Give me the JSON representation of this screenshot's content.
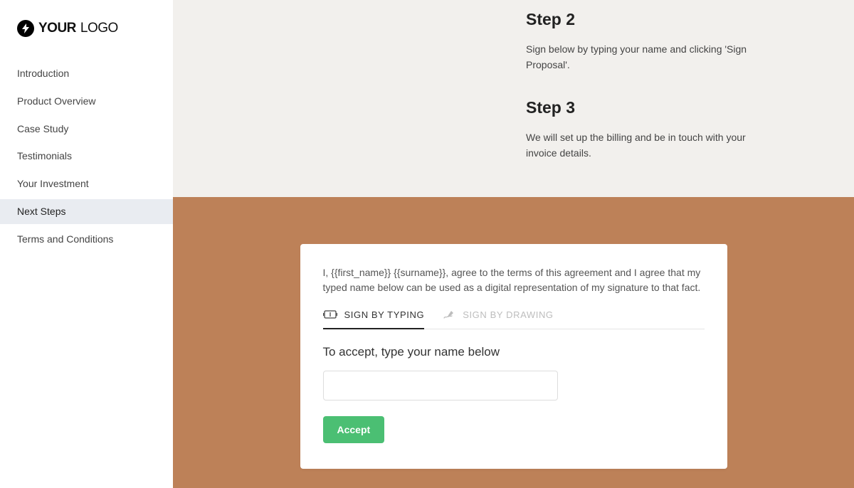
{
  "logo": {
    "part1": "YOUR",
    "part2": "LOGO",
    "icon": "bolt-icon"
  },
  "sidebar": {
    "items": [
      {
        "label": "Introduction",
        "active": false
      },
      {
        "label": "Product Overview",
        "active": false
      },
      {
        "label": "Case Study",
        "active": false
      },
      {
        "label": "Testimonials",
        "active": false
      },
      {
        "label": "Your Investment",
        "active": false
      },
      {
        "label": "Next Steps",
        "active": true
      },
      {
        "label": "Terms and Conditions",
        "active": false
      }
    ]
  },
  "steps": {
    "step2": {
      "title": "Step 2",
      "body": "Sign below by typing your name and clicking 'Sign Proposal'."
    },
    "step3": {
      "title": "Step 3",
      "body": "We will set up the billing and be in touch with your invoice details."
    }
  },
  "signCard": {
    "agreement": "I, {{first_name}} {{surname}}, agree to the terms of this agreement and I agree that my typed name below can be used as a digital representation of my signature to that fact.",
    "tabs": {
      "typing": "SIGN BY TYPING",
      "drawing": "SIGN BY DRAWING"
    },
    "fieldLabel": "To accept, type your name below",
    "nameValue": "",
    "acceptLabel": "Accept"
  },
  "colors": {
    "signBg": "#bd8158",
    "acceptBtn": "#4bbf73"
  }
}
